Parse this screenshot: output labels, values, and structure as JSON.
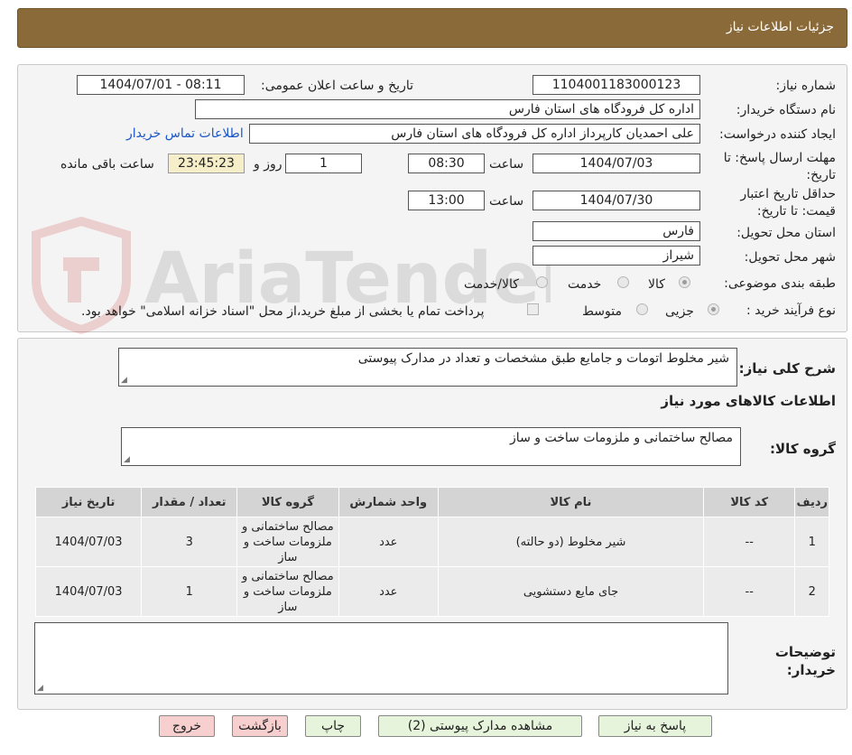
{
  "header": {
    "title": "جزئیات اطلاعات نیاز"
  },
  "watermark_text": "AriaTender.neT",
  "fields": {
    "need_number_label": "شماره نیاز:",
    "need_number": "1104001183000123",
    "announce_label": "تاریخ و ساعت اعلان عمومی:",
    "announce_value": "1404/07/01 - 08:11",
    "buyer_label": "نام دستگاه خریدار:",
    "buyer_value": "اداره کل فرودگاه های استان فارس",
    "creator_label": "ایجاد کننده درخواست:",
    "creator_value": "علی  احمدیان کارپرداز اداره کل فرودگاه های استان فارس",
    "contact_link": "اطلاعات تماس خریدار",
    "deadline_label": "مهلت ارسال پاسخ: تا تاریخ:",
    "deadline_date": "1404/07/03",
    "time_label": "ساعت",
    "deadline_time": "08:30",
    "days_value": "1",
    "days_label": "روز و",
    "remaining_time": "23:45:23",
    "remaining_label": "ساعت باقی مانده",
    "validity_label": "حداقل تاریخ اعتبار قیمت: تا تاریخ:",
    "validity_date": "1404/07/30",
    "validity_time": "13:00",
    "province_label": "استان محل تحویل:",
    "province_value": "فارس",
    "city_label": "شهر محل تحویل:",
    "city_value": "شیراز",
    "category_label": "طبقه بندی موضوعی:",
    "category_options": [
      "کالا",
      "خدمت",
      "کالا/خدمت"
    ],
    "process_label": "نوع فرآیند خرید :",
    "process_options": [
      "جزیی",
      "متوسط"
    ],
    "payment_note": "پرداخت تمام یا بخشی از مبلغ خرید،از محل \"اسناد خزانه اسلامی\" خواهد بود."
  },
  "description": {
    "label": "شرح کلی نیاز:",
    "value": "شیر مخلوط اتومات و جامایع طبق مشخصات و تعداد در مدارک پیوستی"
  },
  "goods_info_title": "اطلاعات کالاهای مورد نیاز",
  "goods_group": {
    "label": "گروه کالا:",
    "value": "مصالح ساختمانی و ملزومات ساخت و ساز"
  },
  "table": {
    "headers": [
      "ردیف",
      "کد کالا",
      "نام کالا",
      "واحد شمارش",
      "گروه کالا",
      "تعداد / مقدار",
      "تاریخ نیاز"
    ],
    "rows": [
      {
        "row": "1",
        "code": "--",
        "name": "شیر مخلوط (دو حالته)",
        "unit": "عدد",
        "group": "مصالح ساختمانی و ملزومات ساخت و ساز",
        "qty": "3",
        "date": "1404/07/03"
      },
      {
        "row": "2",
        "code": "--",
        "name": "جای مایع دستشویی",
        "unit": "عدد",
        "group": "مصالح ساختمانی و ملزومات ساخت و ساز",
        "qty": "1",
        "date": "1404/07/03"
      }
    ]
  },
  "buyer_notes": {
    "label": "توضیحات خریدار:",
    "value": ""
  },
  "buttons": {
    "reply": "پاسخ به نیاز",
    "attachments": "مشاهده مدارک پیوستی (2)",
    "print": "چاپ",
    "back": "بازگشت",
    "exit": "خروج"
  }
}
